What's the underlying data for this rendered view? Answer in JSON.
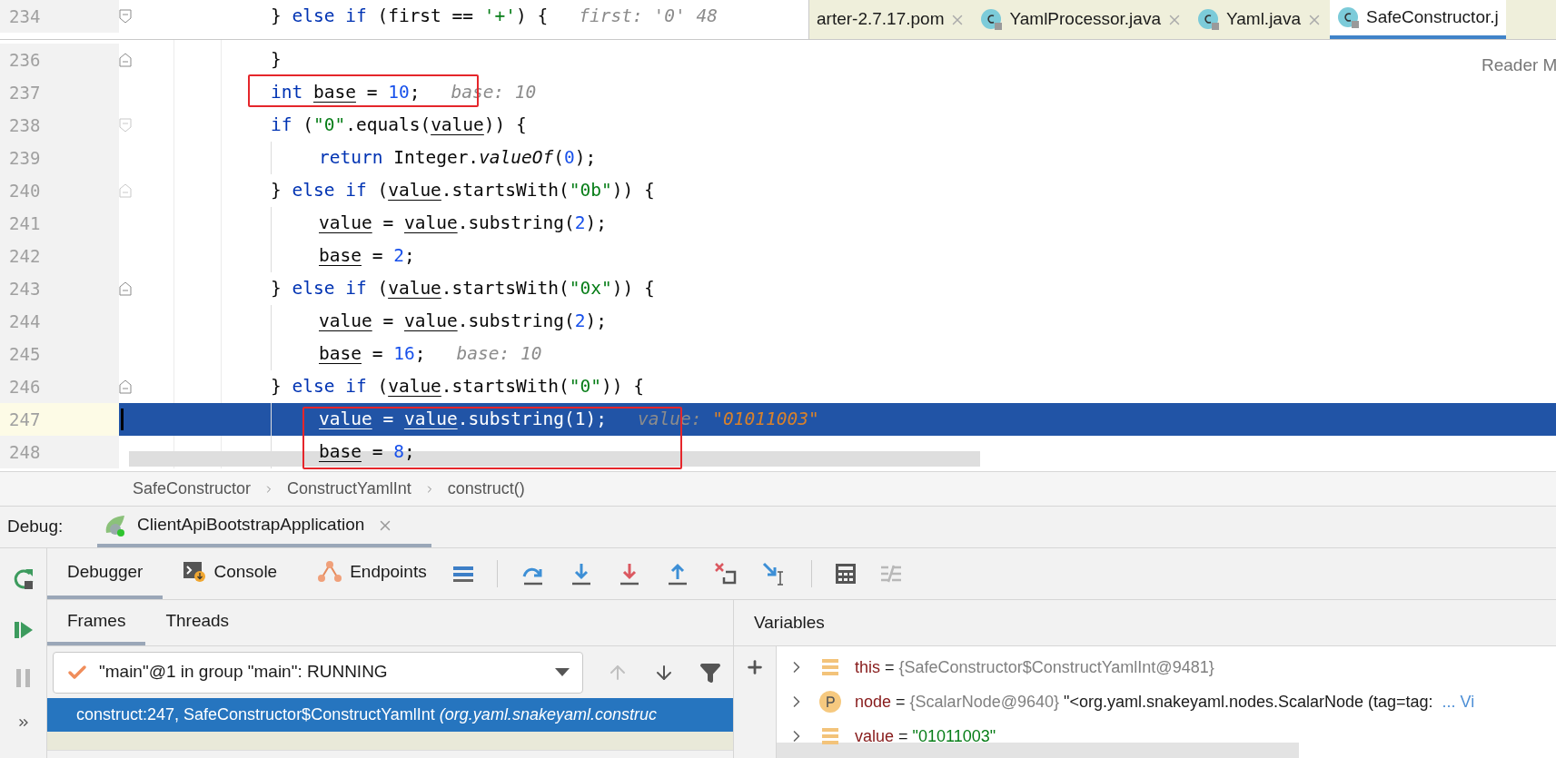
{
  "editor_tabs": [
    {
      "label": "arter-2.7.17.pom",
      "kind": "pom",
      "selected": false
    },
    {
      "label": "YamlProcessor.java",
      "kind": "class",
      "selected": false
    },
    {
      "label": "Yaml.java",
      "kind": "class",
      "selected": false
    },
    {
      "label": "SafeConstructor.j",
      "kind": "class",
      "selected": true
    }
  ],
  "reader_mode": "Reader M",
  "code_lines": [
    {
      "number": "234",
      "nested": false,
      "kind": "open",
      "selected": false,
      "tokens": [
        {
          "text": "} ",
          "kind": "plain"
        },
        {
          "text": "else if",
          "kind": "keyword"
        },
        {
          "text": " (first == ",
          "kind": "plain"
        },
        {
          "text": "'+'",
          "kind": "string"
        },
        {
          "text": ") {",
          "kind": "plain"
        }
      ],
      "hint": {
        "label": "first:",
        "value": "'0' 48"
      }
    },
    {
      "number": "236",
      "nested": false,
      "kind": "close",
      "selected": false,
      "tokens": [
        {
          "text": "}",
          "kind": "plain"
        }
      ]
    },
    {
      "number": "237",
      "nested": false,
      "kind": "plain",
      "selected": false,
      "tokens": [
        {
          "text": "int ",
          "kind": "keyword"
        },
        {
          "text": "base",
          "kind": "var"
        },
        {
          "text": " = ",
          "kind": "plain"
        },
        {
          "text": "10",
          "kind": "number"
        },
        {
          "text": ";",
          "kind": "plain"
        }
      ],
      "hint": {
        "label": "base:",
        "value": "10"
      }
    },
    {
      "number": "238",
      "nested": false,
      "kind": "open",
      "selected": false,
      "tokens": [
        {
          "text": "if",
          "kind": "keyword"
        },
        {
          "text": " (",
          "kind": "plain"
        },
        {
          "text": "\"0\"",
          "kind": "string"
        },
        {
          "text": ".equals(",
          "kind": "plain"
        },
        {
          "text": "value",
          "kind": "var"
        },
        {
          "text": ")) {",
          "kind": "plain"
        }
      ]
    },
    {
      "number": "239",
      "nested": true,
      "kind": "plain",
      "selected": false,
      "tokens": [
        {
          "text": "return",
          "kind": "keyword"
        },
        {
          "text": " Integer.",
          "kind": "plain"
        },
        {
          "text": "valueOf",
          "kind": "static"
        },
        {
          "text": "(",
          "kind": "plain"
        },
        {
          "text": "0",
          "kind": "number"
        },
        {
          "text": ");",
          "kind": "plain"
        }
      ]
    },
    {
      "number": "240",
      "nested": false,
      "kind": "close",
      "selected": false,
      "tokens": [
        {
          "text": "} ",
          "kind": "plain"
        },
        {
          "text": "else if",
          "kind": "keyword"
        },
        {
          "text": " (",
          "kind": "plain"
        },
        {
          "text": "value",
          "kind": "var"
        },
        {
          "text": ".startsWith(",
          "kind": "plain"
        },
        {
          "text": "\"0b\"",
          "kind": "string"
        },
        {
          "text": ")) {",
          "kind": "plain"
        }
      ]
    },
    {
      "number": "241",
      "nested": true,
      "kind": "plain",
      "selected": false,
      "tokens": [
        {
          "text": "value",
          "kind": "var"
        },
        {
          "text": " = ",
          "kind": "plain"
        },
        {
          "text": "value",
          "kind": "var"
        },
        {
          "text": ".substring(",
          "kind": "plain"
        },
        {
          "text": "2",
          "kind": "number"
        },
        {
          "text": ");",
          "kind": "plain"
        }
      ]
    },
    {
      "number": "242",
      "nested": true,
      "kind": "plain",
      "selected": false,
      "tokens": [
        {
          "text": "base",
          "kind": "var"
        },
        {
          "text": " = ",
          "kind": "plain"
        },
        {
          "text": "2",
          "kind": "number"
        },
        {
          "text": ";",
          "kind": "plain"
        }
      ]
    },
    {
      "number": "243",
      "nested": false,
      "kind": "close",
      "selected": false,
      "tokens": [
        {
          "text": "} ",
          "kind": "plain"
        },
        {
          "text": "else if",
          "kind": "keyword"
        },
        {
          "text": " (",
          "kind": "plain"
        },
        {
          "text": "value",
          "kind": "var"
        },
        {
          "text": ".startsWith(",
          "kind": "plain"
        },
        {
          "text": "\"0x\"",
          "kind": "string"
        },
        {
          "text": ")) {",
          "kind": "plain"
        }
      ]
    },
    {
      "number": "244",
      "nested": true,
      "kind": "plain",
      "selected": false,
      "tokens": [
        {
          "text": "value",
          "kind": "var"
        },
        {
          "text": " = ",
          "kind": "plain"
        },
        {
          "text": "value",
          "kind": "var"
        },
        {
          "text": ".substring(",
          "kind": "plain"
        },
        {
          "text": "2",
          "kind": "number"
        },
        {
          "text": ");",
          "kind": "plain"
        }
      ]
    },
    {
      "number": "245",
      "nested": true,
      "kind": "plain",
      "selected": false,
      "tokens": [
        {
          "text": "base",
          "kind": "var"
        },
        {
          "text": " = ",
          "kind": "plain"
        },
        {
          "text": "16",
          "kind": "number"
        },
        {
          "text": ";",
          "kind": "plain"
        }
      ],
      "hint": {
        "label": "base:",
        "value": "10"
      }
    },
    {
      "number": "246",
      "nested": false,
      "kind": "close",
      "selected": false,
      "tokens": [
        {
          "text": "} ",
          "kind": "plain"
        },
        {
          "text": "else if",
          "kind": "keyword"
        },
        {
          "text": " (",
          "kind": "plain"
        },
        {
          "text": "value",
          "kind": "var"
        },
        {
          "text": ".startsWith(",
          "kind": "plain"
        },
        {
          "text": "\"0\"",
          "kind": "string"
        },
        {
          "text": ")) {",
          "kind": "plain"
        }
      ]
    },
    {
      "number": "247",
      "nested": true,
      "kind": "plain",
      "selected": true,
      "tokens": [
        {
          "text": "value",
          "kind": "var"
        },
        {
          "text": " = ",
          "kind": "plain"
        },
        {
          "text": "value",
          "kind": "var"
        },
        {
          "text": ".substring(",
          "kind": "plain"
        },
        {
          "text": "1",
          "kind": "number"
        },
        {
          "text": ");",
          "kind": "plain"
        }
      ],
      "hint": {
        "label": "value:",
        "value": "\"01011003\""
      }
    },
    {
      "number": "248",
      "nested": true,
      "kind": "plain",
      "selected": false,
      "tokens": [
        {
          "text": "base",
          "kind": "var"
        },
        {
          "text": " = ",
          "kind": "plain"
        },
        {
          "text": "8",
          "kind": "number"
        },
        {
          "text": ";",
          "kind": "plain"
        }
      ]
    }
  ],
  "breadcrumbs": [
    "SafeConstructor",
    "ConstructYamlInt",
    "construct()"
  ],
  "debug": {
    "label": "Debug:",
    "session": "ClientApiBootstrapApplication"
  },
  "toolbar_tabs": [
    {
      "label": "Debugger",
      "kind": "debugger",
      "selected": true
    },
    {
      "label": "Console",
      "kind": "console",
      "selected": false
    },
    {
      "label": "Endpoints",
      "kind": "endpoints",
      "selected": false
    }
  ],
  "frames_tabs": [
    {
      "label": "Frames",
      "selected": true
    },
    {
      "label": "Threads",
      "selected": false
    }
  ],
  "thread": {
    "value": "\"main\"@1 in group \"main\": RUNNING"
  },
  "frames": [
    {
      "text": "construct:247, SafeConstructor$ConstructYamlInt *(org.yaml.snakeyaml.construc*",
      "selected": true
    },
    {
      "selected": false
    }
  ],
  "variables": {
    "title": "Variables",
    "rows": [
      {
        "kind": "field",
        "name": "this",
        "operator": "=",
        "value": "{SafeConstructor$ConstructYamlInt@9481}",
        "color": "#808080"
      },
      {
        "kind": "param",
        "name": "node",
        "operator": "=",
        "value": "{ScalarNode@9640}",
        "detail": "\"<org.yaml.snakeyaml.nodes.ScalarNode (tag=tag:",
        "link": "... Vi",
        "color": "#808080"
      },
      {
        "kind": "field",
        "name": "value",
        "operator": "=",
        "value": "\"01011003\"",
        "color": "#067d17"
      }
    ]
  }
}
